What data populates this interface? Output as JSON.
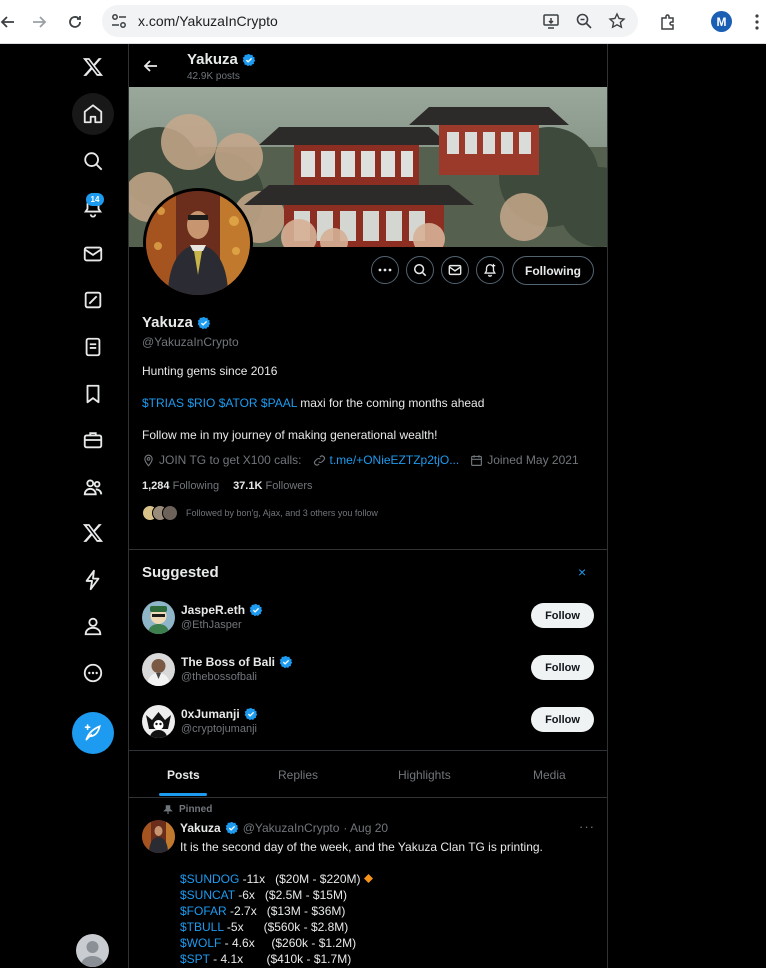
{
  "browser": {
    "url": "x.com/YakuzaInCrypto",
    "profile_initial": "M"
  },
  "nav": {
    "notification_count": "14",
    "items": [
      "x-logo",
      "home",
      "explore",
      "notifications",
      "messages",
      "grok",
      "lists",
      "bookmarks",
      "jobs",
      "communities",
      "premium",
      "verified-orgs",
      "profile",
      "more"
    ]
  },
  "header": {
    "name": "Yakuza",
    "posts_count": "42.9K posts"
  },
  "profile": {
    "name": "Yakuza",
    "handle": "@YakuzaInCrypto",
    "bio_line1": "Hunting gems since 2016",
    "bio_tickers": "$TRIAS $RIO $ATOR $PAAL",
    "bio_line2_rest": " maxi for the coming months ahead",
    "bio_line3": "Follow me in my journey of making generational wealth!",
    "location": "JOIN TG to get X100 calls:",
    "link": "t.me/+ONieEZTZp2tjO...",
    "joined": "Joined May 2021",
    "following_count": "1,284",
    "following_label": "Following",
    "followers_count": "37.1K",
    "followers_label": "Followers",
    "followed_by": "Followed by bon'g, Ajax, and 3 others you follow",
    "following_button": "Following"
  },
  "suggested": {
    "title": "Suggested",
    "close": "×",
    "accounts": [
      {
        "name": "JaspeR.eth",
        "handle": "@EthJasper",
        "button": "Follow"
      },
      {
        "name": "The Boss of Bali",
        "handle": "@thebossofbali",
        "button": "Follow"
      },
      {
        "name": "0xJumanji",
        "handle": "@cryptojumanji",
        "button": "Follow"
      }
    ]
  },
  "tabs": [
    "Posts",
    "Replies",
    "Highlights",
    "Media"
  ],
  "post": {
    "pinned_label": "Pinned",
    "author": "Yakuza",
    "handle": "@YakuzaInCrypto",
    "date": "· Aug 20",
    "more": "···",
    "text": "It is the second day of the week, and the Yakuza Clan TG  is printing.",
    "lines": [
      {
        "ticker": "$SUNDOG",
        "rest": " -11x   ($20M - $220M)"
      },
      {
        "ticker": "$SUNCAT",
        "rest": " -6x   ($2.5M - $15M)"
      },
      {
        "ticker": "$FOFAR",
        "rest": " -2.7x   ($13M - $36M)"
      },
      {
        "ticker": "$TBULL",
        "rest": " -5x      ($560k - $2.8M)"
      },
      {
        "ticker": "$WOLF",
        "rest": " - 4.6x     ($260k - $1.2M)"
      },
      {
        "ticker": "$SPT",
        "rest": " - 4.1x       ($410k - $1.7M)"
      }
    ]
  },
  "colors": {
    "accent": "#1d9bf0",
    "background": "#000000",
    "border": "#2f3336",
    "muted": "#71767b",
    "orange_diamond": "#f7931a"
  }
}
